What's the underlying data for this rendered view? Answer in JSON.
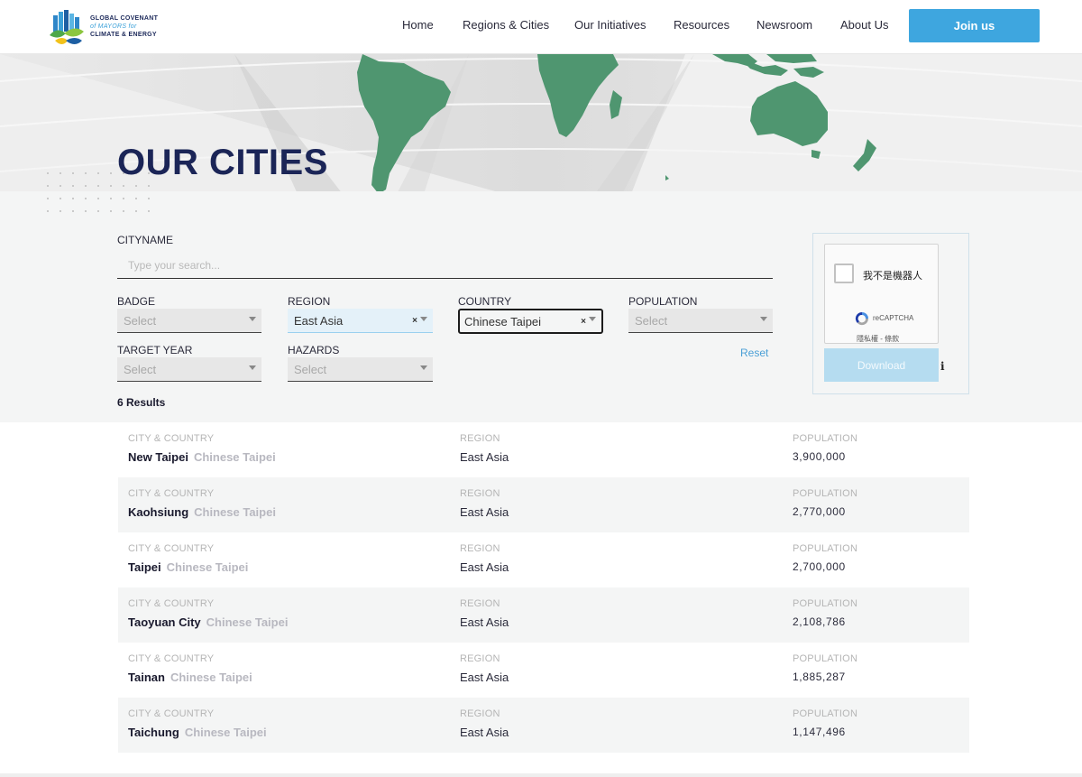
{
  "header": {
    "logo_lines": [
      "GLOBAL COVENANT",
      "of MAYORS for",
      "CLIMATE & ENERGY"
    ],
    "nav": [
      "Home",
      "Regions & Cities",
      "Our Initiatives",
      "Resources",
      "Newsroom",
      "About Us"
    ],
    "join_label": "Join us"
  },
  "hero": {
    "title": "OUR CITIES"
  },
  "filters": {
    "cityname_label": "CITYNAME",
    "cityname_placeholder": "Type your search...",
    "badge_label": "BADGE",
    "badge_value": "Select",
    "region_label": "REGION",
    "region_value": "East Asia",
    "country_label": "COUNTRY",
    "country_value": "Chinese Taipei",
    "population_label": "POPULATION",
    "population_value": "Select",
    "target_year_label": "TARGET YEAR",
    "target_year_value": "Select",
    "hazards_label": "HAZARDS",
    "hazards_value": "Select",
    "clear_glyph": "×",
    "reset_label": "Reset",
    "results_text": "6 Results"
  },
  "captcha": {
    "checkbox_text": "我不是機器人",
    "brand": "reCAPTCHA",
    "terms": "隱私權 - 條款",
    "download_label": "Download",
    "info_glyph": "i"
  },
  "table": {
    "col_city": "CITY & COUNTRY",
    "col_region": "REGION",
    "col_population": "POPULATION",
    "rows": [
      {
        "city": "New Taipei",
        "country": "Chinese Taipei",
        "region": "East Asia",
        "population": "3,900,000"
      },
      {
        "city": "Kaohsiung",
        "country": "Chinese Taipei",
        "region": "East Asia",
        "population": "2,770,000"
      },
      {
        "city": "Taipei",
        "country": "Chinese Taipei",
        "region": "East Asia",
        "population": "2,700,000"
      },
      {
        "city": "Taoyuan City",
        "country": "Chinese Taipei",
        "region": "East Asia",
        "population": "2,108,786"
      },
      {
        "city": "Tainan",
        "country": "Chinese Taipei",
        "region": "East Asia",
        "population": "1,885,287"
      },
      {
        "city": "Taichung",
        "country": "Chinese Taipei",
        "region": "East Asia",
        "population": "1,147,496"
      }
    ]
  },
  "colors": {
    "accent": "#3ea6df",
    "title": "#1b2557",
    "map_green": "#4f9670"
  }
}
